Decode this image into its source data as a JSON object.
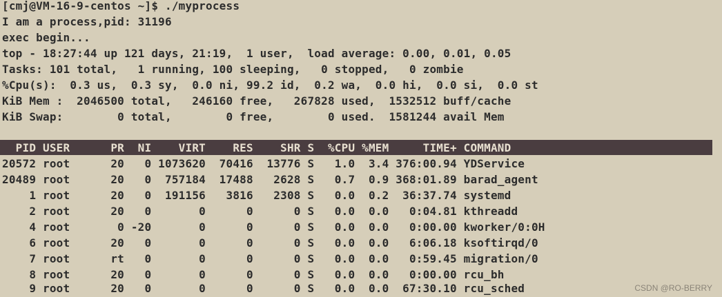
{
  "terminal": {
    "lines": [
      "[cmj@VM-16-9-centos ~]$ ./myprocess",
      "I am a process,pid: 31196",
      "exec begin...",
      "top - 18:27:44 up 121 days, 21:19,  1 user,  load average: 0.00, 0.01, 0.05",
      "Tasks: 101 total,   1 running, 100 sleeping,   0 stopped,   0 zombie",
      "%Cpu(s):  0.3 us,  0.3 sy,  0.0 ni, 99.2 id,  0.2 wa,  0.0 hi,  0.0 si,  0.0 st",
      "KiB Mem :  2046500 total,   246160 free,   267828 used,  1532512 buff/cache",
      "KiB Swap:        0 total,        0 free,        0 used.  1581244 avail Mem"
    ],
    "table_header": "  PID USER      PR  NI    VIRT    RES    SHR S  %CPU %MEM     TIME+ COMMAND",
    "table_rows": [
      "20572 root      20   0 1073620  70416  13776 S   1.0  3.4 376:00.94 YDService",
      "20489 root      20   0  757184  17488   2628 S   0.7  0.9 368:01.89 barad_agent",
      "    1 root      20   0  191156   3816   2308 S   0.0  0.2  36:37.74 systemd",
      "    2 root      20   0       0      0      0 S   0.0  0.0   0:04.81 kthreadd",
      "    4 root       0 -20       0      0      0 S   0.0  0.0   0:00.00 kworker/0:0H",
      "    6 root      20   0       0      0      0 S   0.0  0.0   6:06.18 ksoftirqd/0",
      "    7 root      rt   0       0      0      0 S   0.0  0.0   0:59.45 migration/0",
      "    8 root      20   0       0      0      0 S   0.0  0.0   0:00.00 rcu_bh",
      "    9 root      20   0       0      0      0 S   0.0  0.0  67:30.10 rcu_sched"
    ]
  },
  "watermark": "CSDN @RO-BERRY",
  "colors": {
    "background": "#d6ceb9",
    "text": "#2c2c2c",
    "header_bar": "#4a3d40",
    "header_text": "#e8e0d0"
  }
}
